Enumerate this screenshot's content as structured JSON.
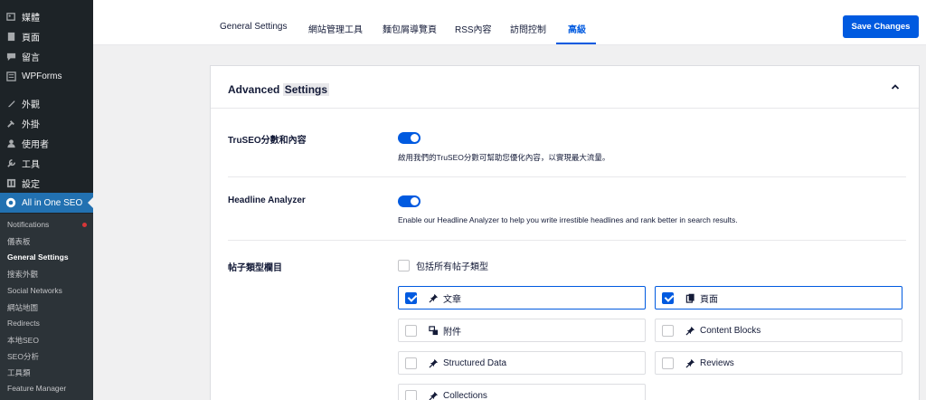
{
  "sidebar": {
    "items": [
      {
        "label": "媒體",
        "icon": "media-icon"
      },
      {
        "label": "頁面",
        "icon": "page-icon"
      },
      {
        "label": "留言",
        "icon": "comment-icon"
      },
      {
        "label": "WPForms",
        "icon": "wpforms-icon"
      },
      {
        "label": "外觀",
        "icon": "appearance-icon"
      },
      {
        "label": "外掛",
        "icon": "plugin-icon"
      },
      {
        "label": "使用者",
        "icon": "user-icon"
      },
      {
        "label": "工具",
        "icon": "tools-icon"
      },
      {
        "label": "設定",
        "icon": "settings-icon"
      },
      {
        "label": "All in One SEO",
        "icon": "aioseo-icon"
      }
    ],
    "submenu": [
      "Notifications",
      "儀表板",
      "General Settings",
      "搜索外觀",
      "Social Networks",
      "網站地圖",
      "Redirects",
      "本地SEO",
      "SEO分析",
      "工具類",
      "Feature Manager"
    ]
  },
  "tabs": [
    "General Settings",
    "網站管理工具",
    "麵包屑導覽頁",
    "RSS內容",
    "訪問控制",
    "高級"
  ],
  "save_label": "Save Changes",
  "card": {
    "title_a": "Advanced",
    "title_b": "Settings",
    "truseo": {
      "label": "TruSEO分數和內容",
      "desc": "啟用我們的TruSEO分數可幫助您優化內容，以實現最大流量。"
    },
    "headline": {
      "label": "Headline Analyzer",
      "desc": "Enable our Headline Analyzer to help you write irrestible headlines and rank better in search results."
    },
    "post_types": {
      "label": "帖子類型欄目",
      "include_all": "包括所有帖子類型",
      "items": [
        {
          "label": "文章",
          "checked": true,
          "icon": "pin-icon"
        },
        {
          "label": "頁面",
          "checked": true,
          "icon": "pages-icon"
        },
        {
          "label": "附件",
          "checked": false,
          "icon": "attachment-icon"
        },
        {
          "label": "Content Blocks",
          "checked": false,
          "icon": "pin-icon"
        },
        {
          "label": "Structured Data",
          "checked": false,
          "icon": "pin-icon"
        },
        {
          "label": "Reviews",
          "checked": false,
          "icon": "pin-icon"
        },
        {
          "label": "Collections",
          "checked": false,
          "icon": "pin-icon"
        }
      ]
    }
  },
  "colors": {
    "accent": "#005ae0",
    "sidebar_bg": "#1d2327",
    "wp_blue": "#2271b1"
  }
}
